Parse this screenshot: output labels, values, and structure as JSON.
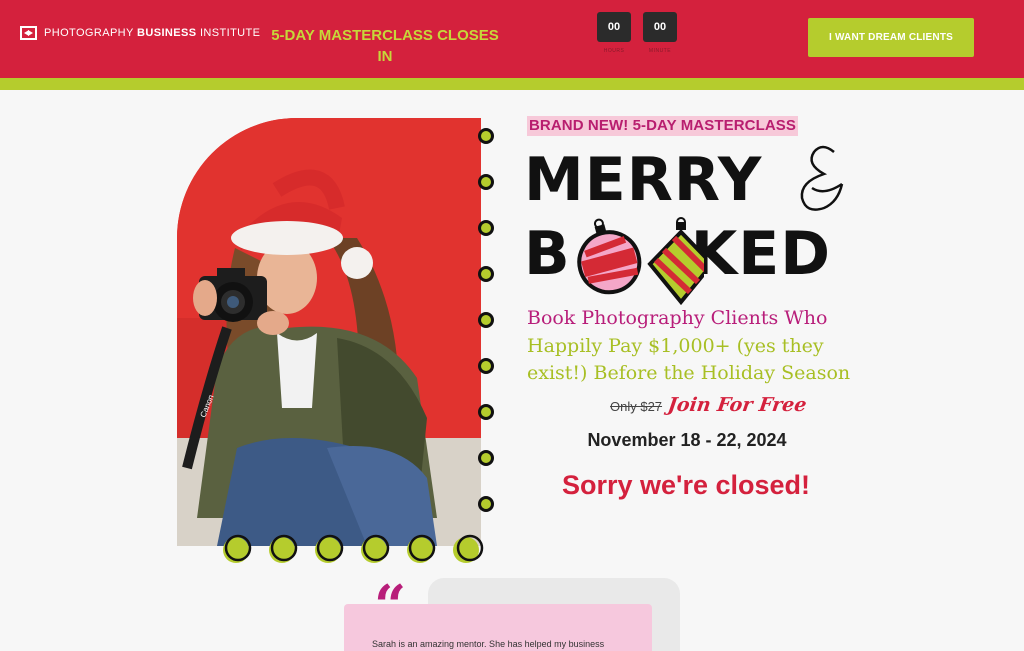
{
  "header": {
    "logo_light": "PHOTOGRAPHY",
    "logo_bold": "BUSINESS",
    "logo_tail": "INSTITUTE",
    "countdown_label": "5-DAY MASTERCLASS CLOSES IN",
    "timer": [
      {
        "value": "00",
        "unit": "HOURS"
      },
      {
        "value": "00",
        "unit": "MINUTE"
      }
    ],
    "cta_label": "I WANT DREAM CLIENTS"
  },
  "hero": {
    "badge": "BRAND NEW! 5-DAY MASTERCLASS",
    "title_line1": "MERRY",
    "title_line2": "BOOKED",
    "title_b": "B",
    "title_rest": "KED",
    "subhead_pink": "Book Photography Clients Who",
    "subhead_green": "Happily Pay $1,000+ (yes they exist!) Before the Holiday Season",
    "old_price": "Only $27",
    "free_label": "Join For Free",
    "dates": "November 18 - 22, 2024",
    "closed": "Sorry we're closed!"
  },
  "photo": {
    "camera_brand": "Canon"
  },
  "testimonial": {
    "quote_mark": "“",
    "text": "Sarah is an amazing mentor. She has helped my business"
  },
  "colors": {
    "brand_red": "#d4213d",
    "lime": "#b5cc2d",
    "pink": "#b81e7a",
    "light_pink": "#f6c8dd"
  }
}
